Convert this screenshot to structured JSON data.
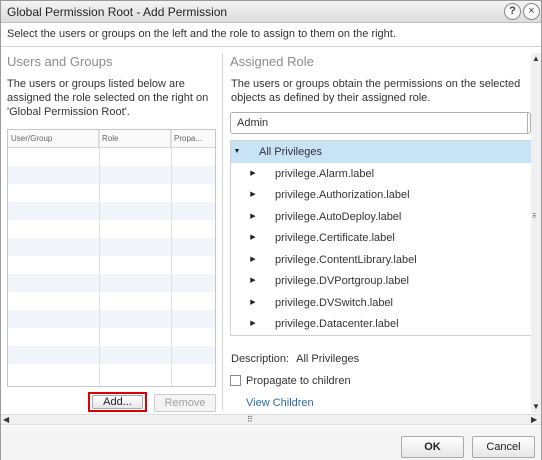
{
  "window": {
    "title": "Global Permission Root - Add Permission",
    "help_glyph": "?",
    "close_glyph": "×"
  },
  "instructions": "Select the users or groups on the left and the role to assign to them on the right.",
  "users_groups": {
    "header": "Users and Groups",
    "description_lines": [
      "The users or groups listed below are",
      "assigned the role selected on the right on",
      "'Global Permission Root'."
    ],
    "columns": [
      "User/Group",
      "Role",
      "Propa..."
    ],
    "rows": [],
    "add_label": "Add...",
    "remove_label": "Remove"
  },
  "assigned_role": {
    "header": "Assigned Role",
    "description_lines": [
      "The users or groups obtain the permissions on the selected",
      "objects as defined by their assigned role."
    ],
    "selected_role": "Admin",
    "tree": [
      {
        "label": "All Privileges",
        "expanded": true
      },
      {
        "label": "privilege.Alarm.label"
      },
      {
        "label": "privilege.Authorization.label"
      },
      {
        "label": "privilege.AutoDeploy.label"
      },
      {
        "label": "privilege.Certificate.label"
      },
      {
        "label": "privilege.ContentLibrary.label"
      },
      {
        "label": "privilege.DVPortgroup.label"
      },
      {
        "label": "privilege.DVSwitch.label"
      },
      {
        "label": "privilege.Datacenter.label"
      }
    ],
    "description_label": "Description:",
    "description_value": "All Privileges",
    "propagate_label": "Propagate to children",
    "propagate_checked": false,
    "view_children_label": "View Children"
  },
  "footer": {
    "ok_label": "OK",
    "cancel_label": "Cancel"
  },
  "icons": {
    "expanded_glyph": "▼",
    "collapsed_glyph": "▶",
    "scroll_up": "▲",
    "scroll_down": "▼",
    "scroll_left": "◀",
    "scroll_right": "▶",
    "grip": "⠿"
  },
  "colors": {
    "selection": "#c8e2f6",
    "link": "#2a6aa6",
    "highlight_border": "#e00000"
  }
}
